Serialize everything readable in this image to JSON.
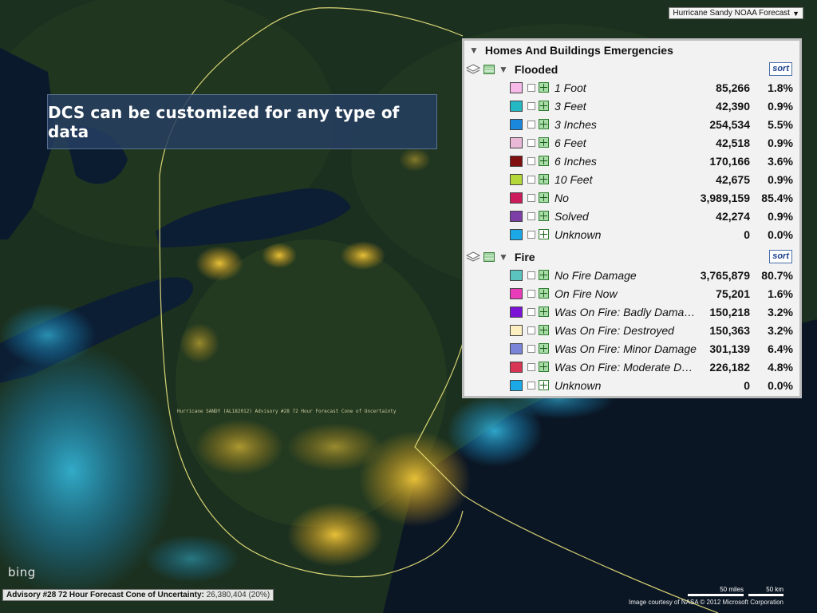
{
  "map": {
    "layer_selector": "Hurricane Sandy NOAA Forecast",
    "track_label": "Hurricane SANDY (AL182012) Advisory #28 72 Hour Forecast Cone of Uncertainty",
    "logo": "bing",
    "colors": {
      "land": "#1a2e1c",
      "water": "#0a1622",
      "lights": "#e0b830",
      "cyan_lights": "#28b8e8",
      "cone": "#e8e07a"
    }
  },
  "banner": {
    "text": "DCS can be customized for any type of data"
  },
  "panel": {
    "title": "Homes And Buildings Emergencies",
    "groups": [
      {
        "name": "Flooded",
        "sort_label": "sort",
        "items": [
          {
            "label": "1 Foot",
            "count": "85,266",
            "pct": "1.8%",
            "color": "#f6b9e8"
          },
          {
            "label": "3 Feet",
            "count": "42,390",
            "pct": "0.9%",
            "color": "#24b8c4"
          },
          {
            "label": "3 Inches",
            "count": "254,534",
            "pct": "5.5%",
            "color": "#1a88dc"
          },
          {
            "label": "6 Feet",
            "count": "42,518",
            "pct": "0.9%",
            "color": "#e8b8d6"
          },
          {
            "label": "6 Inches",
            "count": "170,166",
            "pct": "3.6%",
            "color": "#801010"
          },
          {
            "label": "10 Feet",
            "count": "42,675",
            "pct": "0.9%",
            "color": "#b4d83a"
          },
          {
            "label": "No",
            "count": "3,989,159",
            "pct": "85.4%",
            "color": "#cc1c5c"
          },
          {
            "label": "Solved",
            "count": "42,274",
            "pct": "0.9%",
            "color": "#7e3ea8"
          },
          {
            "label": "Unknown",
            "count": "0",
            "pct": "0.0%",
            "color": "#1aa8e6"
          }
        ]
      },
      {
        "name": "Fire",
        "sort_label": "sort",
        "items": [
          {
            "label": "No Fire Damage",
            "count": "3,765,879",
            "pct": "80.7%",
            "color": "#5cc4be"
          },
          {
            "label": "On Fire Now",
            "count": "75,201",
            "pct": "1.6%",
            "color": "#e83cb8"
          },
          {
            "label": "Was On Fire: Badly Damaged",
            "count": "150,218",
            "pct": "3.2%",
            "color": "#7c14d6"
          },
          {
            "label": "Was On Fire: Destroyed",
            "count": "150,363",
            "pct": "3.2%",
            "color": "#fcefc0"
          },
          {
            "label": "Was On Fire: Minor Damage",
            "count": "301,139",
            "pct": "6.4%",
            "color": "#7a84d8"
          },
          {
            "label": "Was On Fire: Moderate Damage",
            "count": "226,182",
            "pct": "4.8%",
            "color": "#d83454"
          },
          {
            "label": "Unknown",
            "count": "0",
            "pct": "0.0%",
            "color": "#1aa8e6"
          }
        ]
      }
    ]
  },
  "status": {
    "advisory_label": "Advisory #28 72 Hour Forecast Cone of Uncertainty:",
    "advisory_value": "26,380,404 (20%)",
    "scale_miles": "50 miles",
    "scale_km": "50 km",
    "credit": "Image courtesy of NASA   © 2012 Microsoft Corporation"
  }
}
